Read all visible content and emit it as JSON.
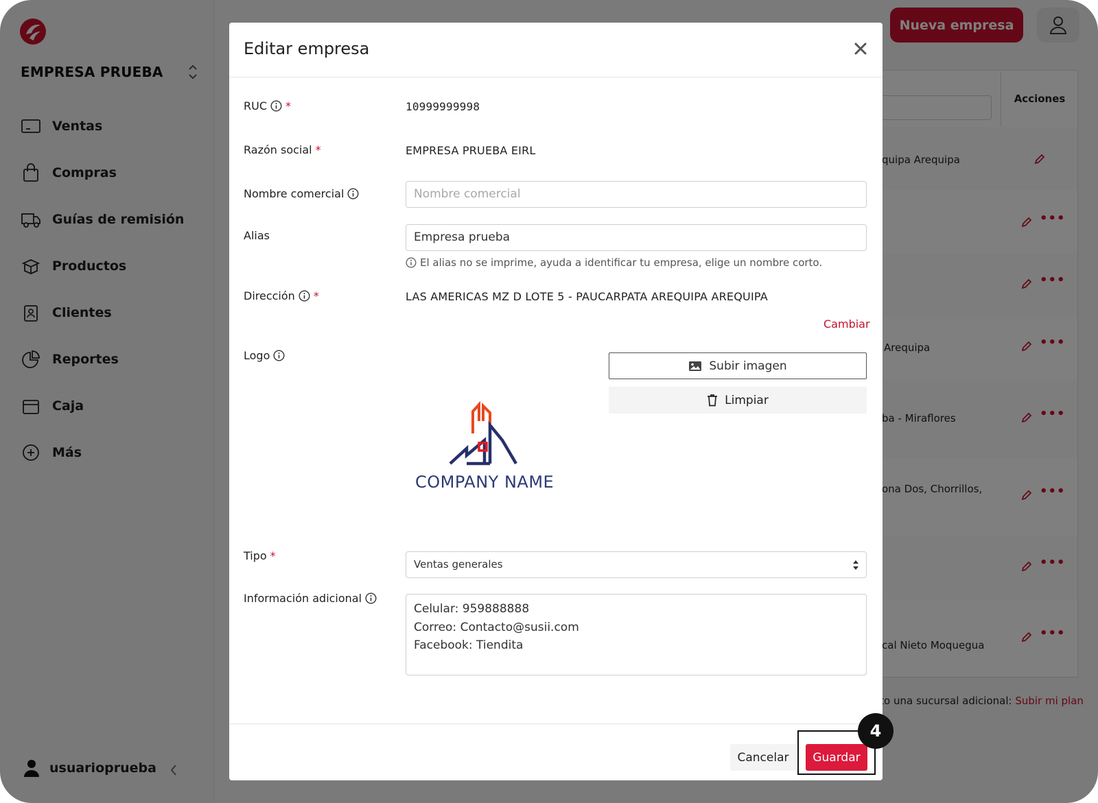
{
  "sidebar": {
    "company_name": "EMPRESA PRUEBA",
    "items": [
      {
        "label": "Ventas",
        "icon": "monitor-icon"
      },
      {
        "label": "Compras",
        "icon": "shopping-bag-icon"
      },
      {
        "label": "Guías de remisión",
        "icon": "truck-icon"
      },
      {
        "label": "Productos",
        "icon": "box-icon"
      },
      {
        "label": "Clientes",
        "icon": "contact-badge-icon"
      },
      {
        "label": "Reportes",
        "icon": "pie-chart-icon"
      },
      {
        "label": "Caja",
        "icon": "cash-box-icon"
      },
      {
        "label": "Más",
        "icon": "plus-circle-icon"
      }
    ],
    "user": "usuarioprueba"
  },
  "header": {
    "new_company_label": "Nueva empresa"
  },
  "table": {
    "actions_header": "Acciones",
    "rows": [
      {
        "text": "quipa Arequipa"
      },
      {
        "text": ""
      },
      {
        "text": ""
      },
      {
        "text": "Arequipa"
      },
      {
        "text": "ba - Miraflores"
      },
      {
        "text": "ona Dos, Chorrillos,"
      },
      {
        "text": ""
      },
      {
        "text": "cal Nieto Moquegua"
      }
    ],
    "upgrade_text": "ito una sucursal adicional: ",
    "upgrade_link": "Subir mi plan"
  },
  "modal": {
    "title": "Editar empresa",
    "ruc_label": "RUC",
    "ruc_value": "10999999998",
    "razon_label": "Razón social",
    "razon_value": "EMPRESA PRUEBA EIRL",
    "nombre_label": "Nombre comercial",
    "nombre_placeholder": "Nombre comercial",
    "alias_label": "Alias",
    "alias_value": "Empresa prueba",
    "alias_help": "El alias no se imprime, ayuda a identificar tu empresa, elige un nombre corto.",
    "direccion_label": "Dirección",
    "direccion_value": "LAS AMERICAS MZ D LOTE 5 - PAUCARPATA AREQUIPA AREQUIPA",
    "cambiar_label": "Cambiar",
    "logo_label": "Logo",
    "logo_caption": "COMPANY NAME",
    "upload_label": "Subir imagen",
    "clear_label": "Limpiar",
    "tipo_label": "Tipo",
    "tipo_value": "Ventas generales",
    "info_label": "Información adicional",
    "info_lines": [
      "Celular: 959888888",
      "Correo: Contacto@susii.com",
      "Facebook: Tiendita"
    ],
    "cancel_label": "Cancelar",
    "save_label": "Guardar",
    "required_mark": "*"
  },
  "annotation": {
    "step": "4"
  },
  "colors": {
    "brand": "#c8102e",
    "save": "#dc1a3c"
  }
}
